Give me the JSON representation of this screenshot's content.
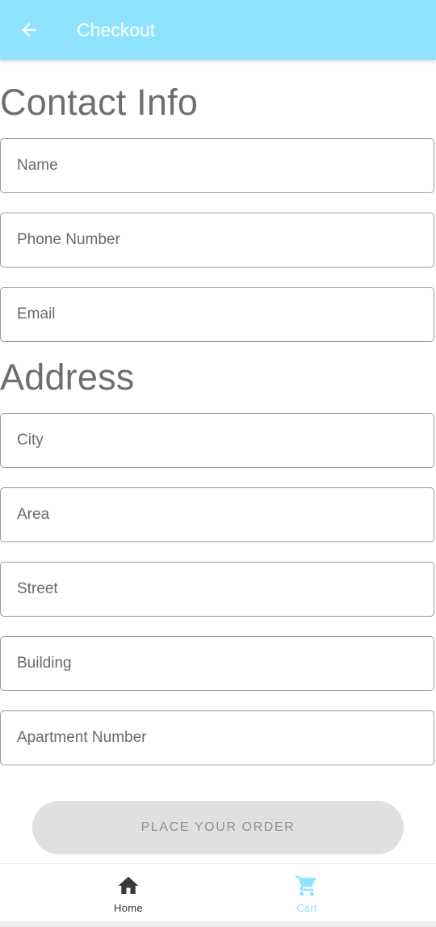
{
  "header": {
    "title": "Checkout",
    "back_icon": "arrow-back-icon",
    "background": "#8fe3ff"
  },
  "contact": {
    "title": "Contact Info",
    "name_placeholder": "Name",
    "phone_placeholder": "Phone Number",
    "email_placeholder": "Email"
  },
  "address": {
    "title": "Address",
    "city_placeholder": "City",
    "area_placeholder": "Area",
    "street_placeholder": "Street",
    "building_placeholder": "Building",
    "apartment_placeholder": "Apartment Number"
  },
  "actions": {
    "place_order_label": "PLACE YOUR ORDER"
  },
  "bottom_nav": {
    "items": [
      {
        "label": "Home",
        "icon": "home-icon",
        "color": "#333333",
        "active": false
      },
      {
        "label": "Cart",
        "icon": "cart-icon",
        "color": "#8fe3ff",
        "active": true
      }
    ]
  }
}
